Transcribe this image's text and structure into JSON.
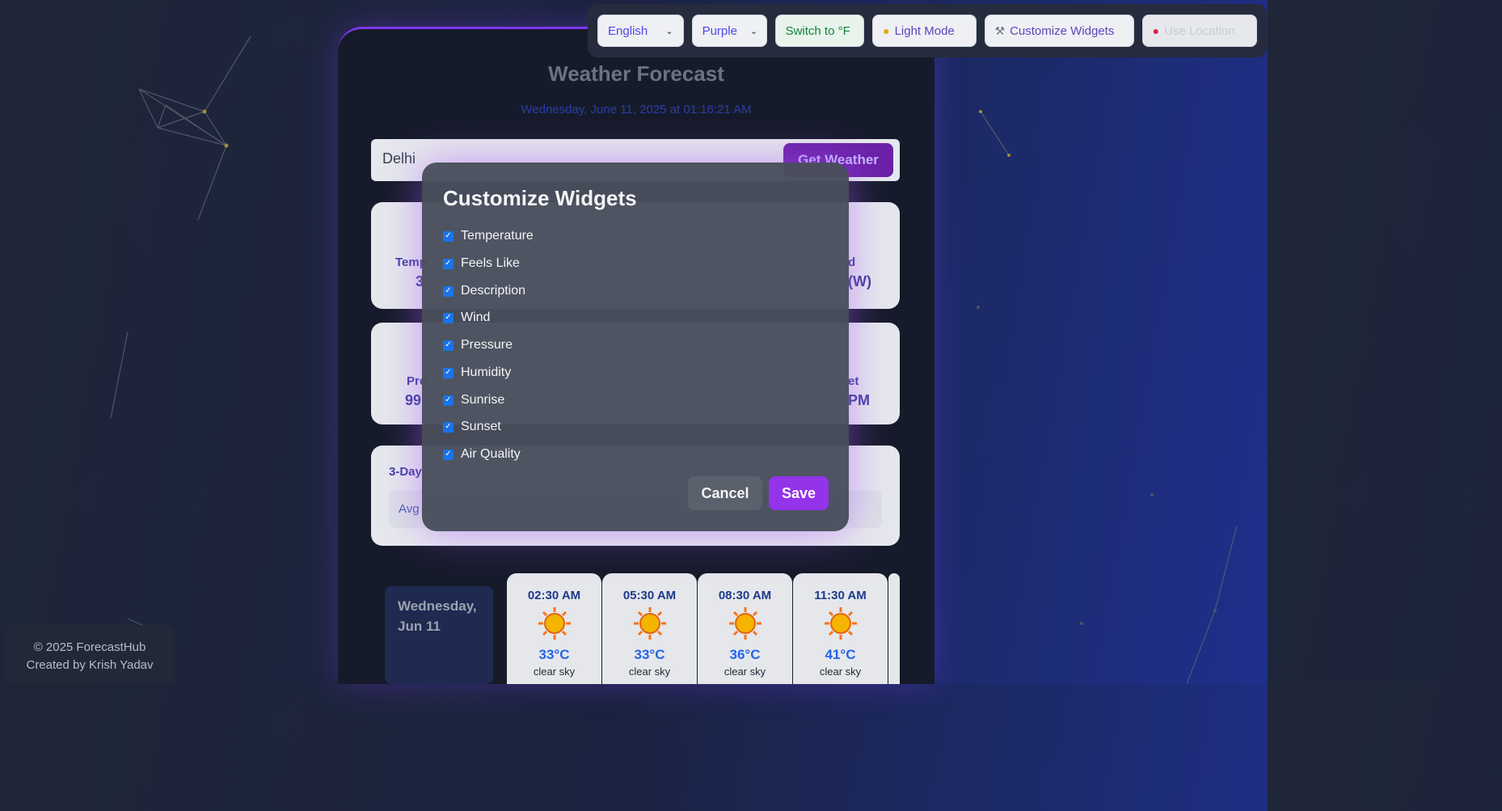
{
  "toolbar": {
    "language": "English",
    "theme_color": "Purple",
    "unit_toggle": "Switch to °F",
    "light_mode": "Light Mode",
    "customize": "Customize Widgets",
    "use_location": "Use Location"
  },
  "header": {
    "title": "Weather Forecast",
    "datetime": "Wednesday, June 11, 2025 at 01:16:21 AM"
  },
  "search": {
    "value": "Delhi",
    "button": "Get Weather"
  },
  "background_peek": {
    "temp_label": "Temp",
    "temp_value": "3",
    "wind_label": "d",
    "wind_value": "(W)",
    "pressure_label": "Pre",
    "pressure_value": "99",
    "sunset_label": "et",
    "sunset_value": "PM",
    "forecast_label": "3-Day",
    "avg_label": "Avg"
  },
  "forecast": {
    "day": "Wednesday, Jun 11",
    "hours": [
      {
        "time": "02:30 AM",
        "temp": "33°C",
        "desc": "clear sky"
      },
      {
        "time": "05:30 AM",
        "temp": "33°C",
        "desc": "clear sky"
      },
      {
        "time": "08:30 AM",
        "temp": "36°C",
        "desc": "clear sky"
      },
      {
        "time": "11:30 AM",
        "temp": "41°C",
        "desc": "clear sky"
      }
    ]
  },
  "footer": {
    "copyright": "© 2025 ForecastHub",
    "credit": "Created by Krish Yadav"
  },
  "modal": {
    "title": "Customize Widgets",
    "options": [
      {
        "label": "Temperature",
        "checked": true
      },
      {
        "label": "Feels Like",
        "checked": true
      },
      {
        "label": "Description",
        "checked": true
      },
      {
        "label": "Wind",
        "checked": true
      },
      {
        "label": "Pressure",
        "checked": true
      },
      {
        "label": "Humidity",
        "checked": true
      },
      {
        "label": "Sunrise",
        "checked": true
      },
      {
        "label": "Sunset",
        "checked": true
      },
      {
        "label": "Air Quality",
        "checked": true
      }
    ],
    "cancel": "Cancel",
    "save": "Save"
  },
  "colors": {
    "accent": "#9333ea",
    "checkbox": "#1a73e8",
    "datetime": "#2b3da6"
  }
}
